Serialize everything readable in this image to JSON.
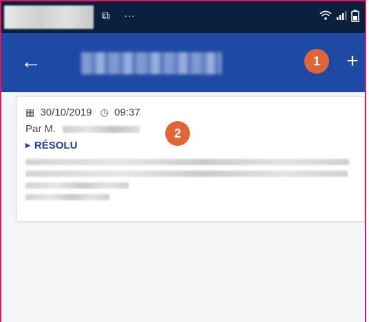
{
  "statusbar": {
    "screenshot_icon": "screenshot-icon",
    "more_dots": "···",
    "wifi_icon": "wifi-icon",
    "signal_icon": "signal-icon",
    "battery_icon": "battery-icon"
  },
  "appbar": {
    "back_glyph": "←",
    "add_glyph": "+",
    "background_color": "#1e4aa5"
  },
  "badges": {
    "one": "1",
    "two": "2",
    "color": "#e0663a"
  },
  "card": {
    "date": "30/10/2019",
    "time": "09:37",
    "author_prefix": "Par M.",
    "status": "RÉSOLU",
    "status_color": "#1e3f8f"
  }
}
